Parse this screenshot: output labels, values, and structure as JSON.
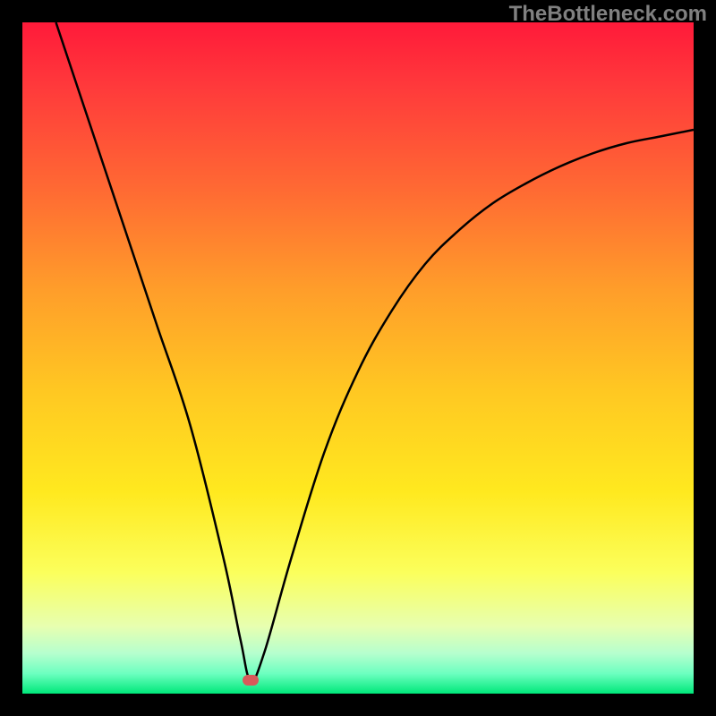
{
  "watermark": "TheBottleneck.com",
  "colors": {
    "frame": "#000000",
    "curve": "#000000",
    "marker": "#d85a5a",
    "gradient_top": "#ff1a3a",
    "gradient_mid": "#ffe91f",
    "gradient_bottom": "#00e87a"
  },
  "chart_data": {
    "type": "line",
    "title": "",
    "xlabel": "",
    "ylabel": "",
    "xlim": [
      0,
      100
    ],
    "ylim": [
      0,
      100
    ],
    "series": [
      {
        "name": "bottleneck-curve",
        "x": [
          5,
          10,
          15,
          20,
          25,
          30,
          32.5,
          34,
          36,
          40,
          45,
          50,
          55,
          60,
          65,
          70,
          75,
          80,
          85,
          90,
          95,
          100
        ],
        "values": [
          100,
          85,
          70,
          55,
          40,
          20,
          8,
          2,
          6,
          20,
          36,
          48,
          57,
          64,
          69,
          73,
          76,
          78.5,
          80.5,
          82,
          83,
          84
        ]
      }
    ],
    "marker": {
      "x": 34,
      "y": 2
    },
    "grid": false,
    "legend": false
  }
}
